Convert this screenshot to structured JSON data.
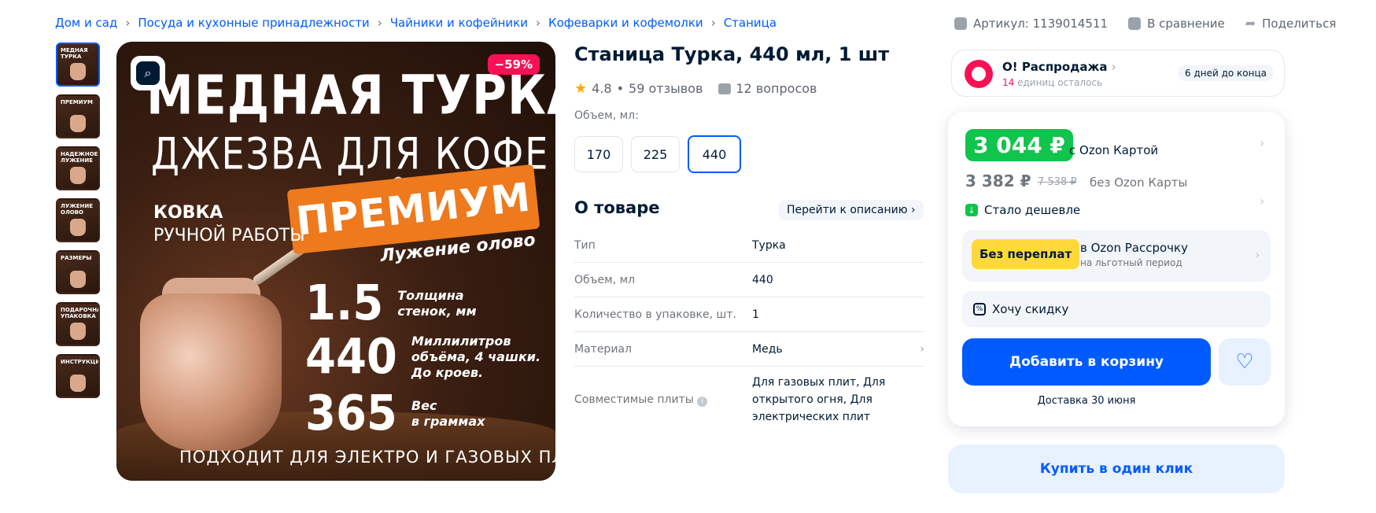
{
  "breadcrumbs": [
    "Дом и сад",
    "Посуда и кухонные принадлежности",
    "Чайники и кофейники",
    "Кофеварки и кофемолки",
    "Станица"
  ],
  "meta": {
    "article": "Артикул: 1139014511",
    "compare": "В сравнение",
    "share": "Поделиться"
  },
  "thumbnails": [
    "МЕДНАЯ ТУРКА",
    "ПРЕМИУМ",
    "НАДЕЖНОЕ ЛУЖЕНИЕ",
    "ЛУЖЕНИЕ ОЛОВО",
    "РАЗМЕРЫ",
    "ПОДАРОЧНАЯ УПАКОВКА",
    "ИНСТРУКЦИЯ"
  ],
  "image": {
    "discount": "−59%",
    "headline1": "МЕДНАЯ ТУРКА",
    "headline2": "ДЖЕЗВА ДЛЯ КОФЕ",
    "premium": "ПРЕМИУМ",
    "kovka1": "КОВКА",
    "kovka2": "РУЧНОЙ РАБОТЫ",
    "luzhenie": "Лужение олово",
    "stats": [
      {
        "num": "1.5",
        "text": "Толщина\nстенок, мм"
      },
      {
        "num": "440",
        "text": "Миллилитров\nобъёма, 4 чашки.\nДо кроев."
      },
      {
        "num": "365",
        "text": "Вес\nв граммах"
      }
    ],
    "footer": "ПОДХОДИТ ДЛЯ ЭЛЕКТРО И ГАЗОВЫХ ПЛИТ"
  },
  "product": {
    "title": "Станица Турка, 440 мл, 1 шт",
    "rating": "4.8",
    "reviews": "59 отзывов",
    "questions": "12 вопросов",
    "volume_label": "Объем, мл:",
    "volumes": [
      "170",
      "225",
      "440"
    ],
    "selected_volume": "440"
  },
  "about": {
    "heading": "О товаре",
    "to_description": "Перейти к описанию",
    "specs": [
      {
        "key": "Тип",
        "value": "Турка"
      },
      {
        "key": "Объем, мл",
        "value": "440"
      },
      {
        "key": "Количество в упаковке, шт.",
        "value": "1"
      },
      {
        "key": "Материал",
        "value": "Медь"
      },
      {
        "key": "Совместимые плиты",
        "value": "Для газовых плит, Для открытого огня, Для электрических плит"
      }
    ]
  },
  "sale": {
    "title": "О! Распродажа",
    "remaining_count": "14",
    "remaining_text": " единиц осталось",
    "days_left": "6 дней до конца"
  },
  "price": {
    "card_price": "3 044 ₽",
    "card_label": "с Ozon Картой",
    "regular_price": "3 382 ₽",
    "old_price": "7 538 ₽",
    "regular_label": "без Ozon Карты",
    "cheaper": "Стало дешевле"
  },
  "installment": {
    "button": "Без переплат",
    "title": "в Ozon Рассрочку",
    "subtitle": "на льготный период"
  },
  "want_discount": "Хочу скидку",
  "add_to_cart": "Добавить в корзину",
  "delivery": "Доставка 30 июня",
  "buy_one_click": "Купить в один клик",
  "colors": {
    "accent": "#005bff",
    "green": "#10c44c",
    "sale": "#f91155",
    "yellow": "#ffd93a"
  }
}
